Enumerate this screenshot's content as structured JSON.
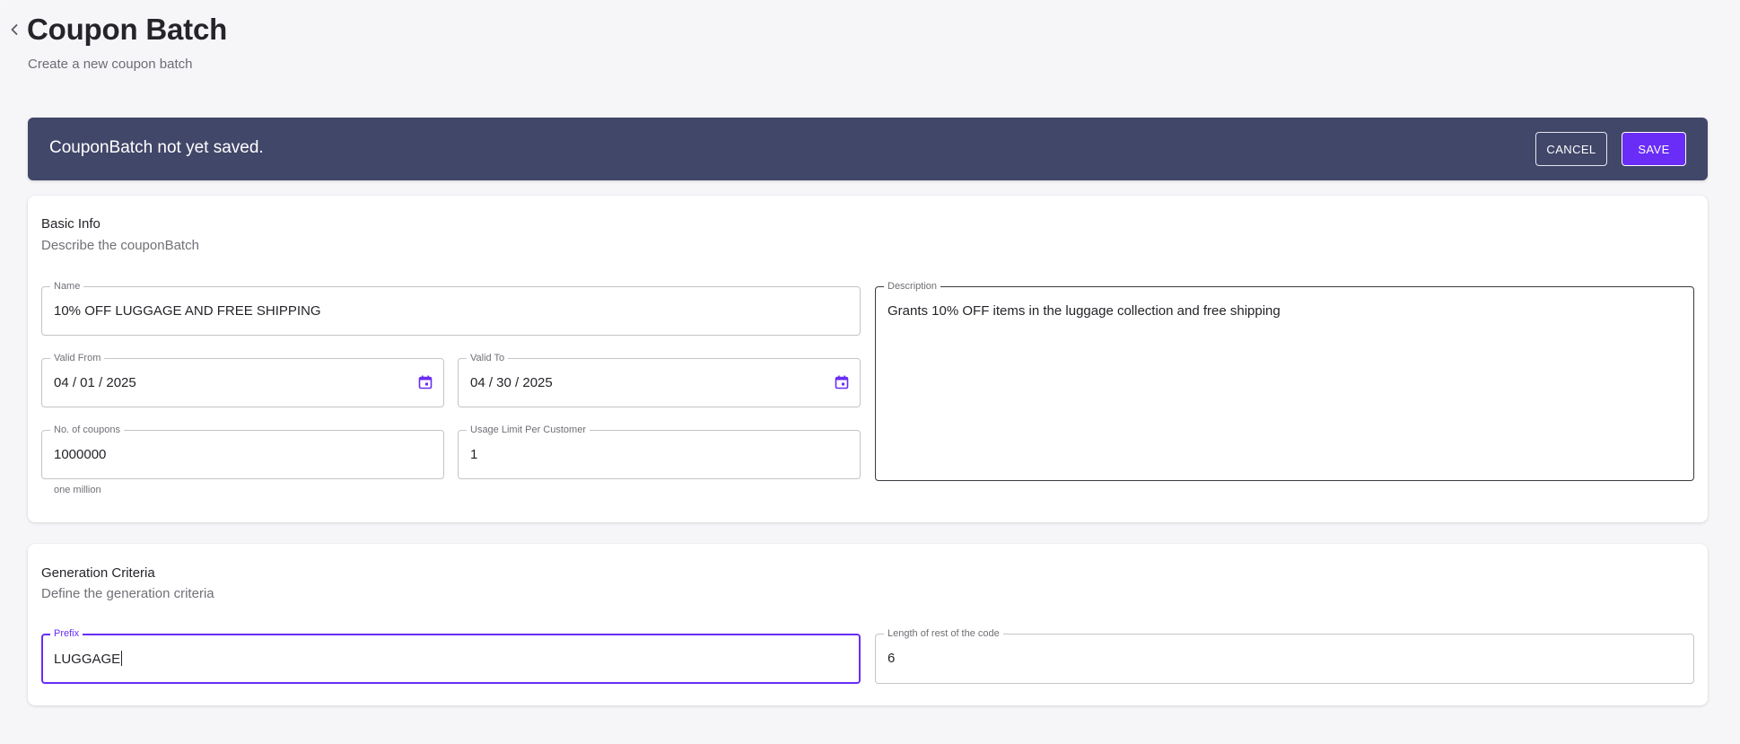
{
  "header": {
    "title": "Coupon Batch",
    "subtitle": "Create a new coupon batch"
  },
  "banner": {
    "message": "CouponBatch not yet saved.",
    "cancel_label": "CANCEL",
    "save_label": "SAVE"
  },
  "basic_info": {
    "heading": "Basic Info",
    "description": "Describe the couponBatch",
    "name": {
      "label": "Name",
      "value": "10% OFF LUGGAGE AND FREE SHIPPING"
    },
    "valid_from": {
      "label": "Valid From",
      "value": "04 / 01 / 2025"
    },
    "valid_to": {
      "label": "Valid To",
      "value": "04 / 30 / 2025"
    },
    "num_coupons": {
      "label": "No. of coupons",
      "value": "1000000",
      "helper": "one million"
    },
    "usage_limit": {
      "label": "Usage Limit Per Customer",
      "value": "1"
    },
    "description_field": {
      "label": "Description",
      "value": "Grants 10% OFF items in the luggage collection and free shipping"
    }
  },
  "generation": {
    "heading": "Generation Criteria",
    "description": "Define the generation criteria",
    "prefix": {
      "label": "Prefix",
      "value": "LUGGAGE"
    },
    "code_length": {
      "label": "Length of rest of the code",
      "value": "6"
    }
  },
  "colors": {
    "banner_bg": "#414769",
    "accent": "#6a2cf7",
    "page_bg": "#f6f6f9"
  },
  "icons": {
    "back": "chevron-left-icon",
    "calendar": "calendar-icon"
  }
}
